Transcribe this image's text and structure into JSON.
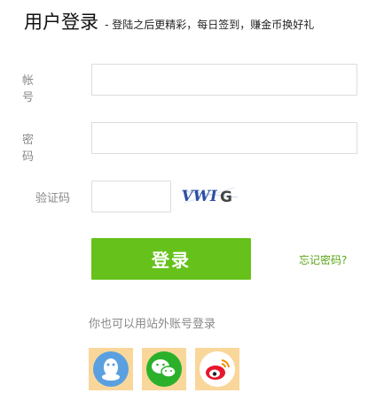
{
  "header": {
    "title": "用户登录",
    "subtitle": "- 登陆之后更精彩，每日签到，赚金币换好礼"
  },
  "form": {
    "account_label": "帐号",
    "password_label": "密码",
    "captcha_label": "验证码",
    "captcha_text": "VWIG",
    "login_label": "登录",
    "forgot_label": "忘记密码?"
  },
  "third_party": {
    "label": "你也可以用站外账号登录",
    "providers": [
      "qq-icon",
      "wechat-icon",
      "weibo-icon"
    ]
  },
  "colors": {
    "accent": "#66c21b",
    "link": "#5aa516",
    "social_bg": "#f9d79b",
    "qq": "#5aa0e0",
    "wechat": "#2bb02b",
    "weibo": "#e6162d"
  }
}
